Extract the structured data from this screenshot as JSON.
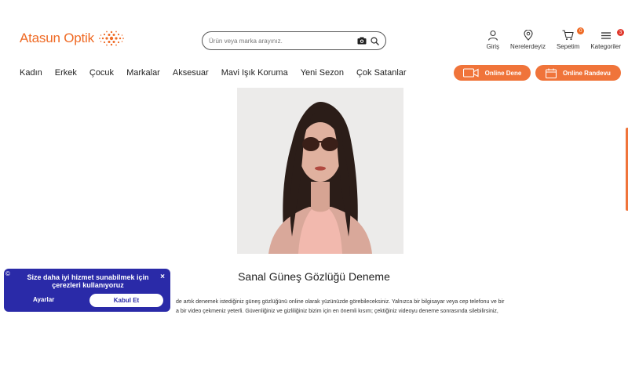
{
  "brand": {
    "name": "Atasun Optik",
    "accent_color": "#ef6a24"
  },
  "search": {
    "placeholder": "Ürün veya marka arayınız.",
    "icons": [
      "camera-icon",
      "search-icon"
    ]
  },
  "top_nav": [
    {
      "label": "Giriş",
      "icon": "user-icon"
    },
    {
      "label": "Nerelerdeyiz",
      "icon": "location-pin-icon"
    },
    {
      "label": "Sepetim",
      "icon": "cart-icon",
      "badge": "0"
    },
    {
      "label": "Kategoriler",
      "icon": "menu-icon",
      "badge": "3"
    }
  ],
  "main_nav": [
    "Kadın",
    "Erkek",
    "Çocuk",
    "Markalar",
    "Aksesuar",
    "Mavi Işık Koruma",
    "Yeni Sezon",
    "Çok Satanlar"
  ],
  "cta": {
    "online_dene": "Online Dene",
    "online_randevu": "Online Randevu",
    "color": "#f0743a"
  },
  "content": {
    "title": "Sanal Güneş Gözlüğü Deneme",
    "paragraph_line1": "de artık denemek istediğiniz güneş gözlüğünü online olarak yüzünüzde görebileceksiniz. Yalnızca bir bilgisayar veya cep telefonu ve bir",
    "paragraph_line2": "a bir video çekmeniz yeterli. Güvenliğiniz ve gizliliğiniz bizim için en önemli kısım; çektiğiniz videoyu deneme sonrasında silebilirsiniz,"
  },
  "cookie_banner": {
    "message": "Size daha iyi hizmet sunabilmek için çerezleri kullanıyoruz",
    "settings_label": "Ayarlar",
    "accept_label": "Kabul Et",
    "close_label": "×",
    "color": "#2a2aa8"
  }
}
